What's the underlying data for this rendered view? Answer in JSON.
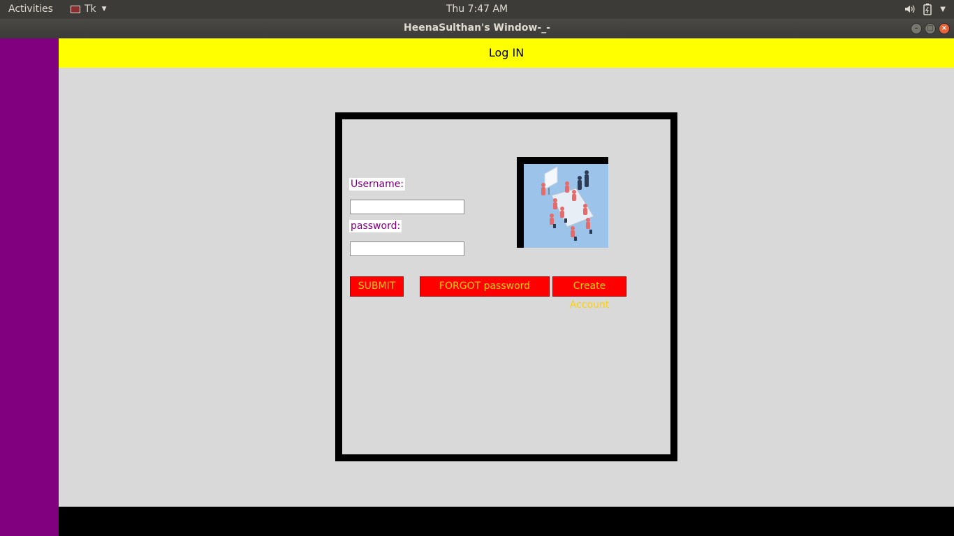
{
  "topbar": {
    "activities": "Activities",
    "app_name": "Tk",
    "clock": "Thu  7:47 AM",
    "icons": [
      "volume-icon",
      "battery-icon",
      "system-menu-icon"
    ]
  },
  "window": {
    "title": "HeenaSulthan's Window-_-"
  },
  "header": {
    "title": "Log IN"
  },
  "form": {
    "username_label": "Username:",
    "username_value": "",
    "password_label": "password:",
    "password_value": ""
  },
  "buttons": {
    "submit": "SUBMIT",
    "forgot": "FORGOT password",
    "create": "Create Account"
  },
  "image": {
    "icon": "team-meeting-illustration"
  },
  "colors": {
    "sidebar": "#800080",
    "header": "#ffff00",
    "button_bg": "#ff0000",
    "button_text": "#ffd000",
    "label_text": "#800080"
  }
}
